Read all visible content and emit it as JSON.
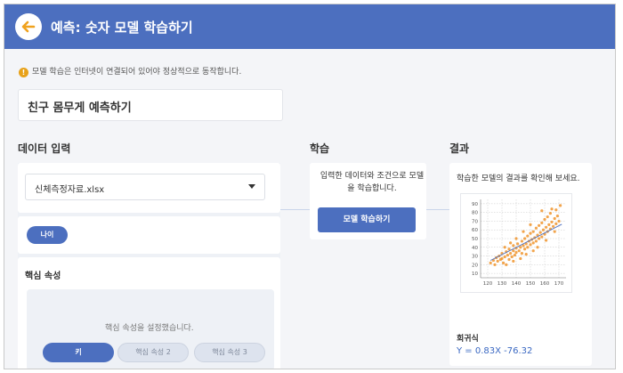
{
  "app": {
    "title": "예측: 숫자 모델 학습하기",
    "notice": "모델 학습은 인터넷이 연결되어 있어야 정상적으로 동작합니다.",
    "project_name": "친구 몸무게 예측하기"
  },
  "data_input": {
    "section_title": "데이터 입력",
    "file_select": "신체측정자료.xlsx",
    "label_chip": "나이",
    "core_attr_title": "핵심 속성",
    "core_attr_placeholder": "핵심 속성을 설정했습니다.",
    "core_attr_chips": [
      "키",
      "핵심 속성 2",
      "핵심 속성 3"
    ]
  },
  "training": {
    "section_title": "학습",
    "description": "입력한 데이터와 조건으로 모델을 학습합니다.",
    "button": "모델 학습하기"
  },
  "result": {
    "section_title": "결과",
    "description": "학습한 모델의 결과를 확인해 보세요.",
    "regression_title": "회귀식",
    "regression_equation": "Y = 0.83X -76.32"
  },
  "colors": {
    "header": "#4c6fbf",
    "accent": "#4c6fbf",
    "scatter": "#f0952e",
    "regression_line": "#4c6fbf",
    "warning": "#e8a21a"
  },
  "icons": {
    "back": "arrow-left-icon",
    "warning": "warning-circle-icon",
    "dropdown": "caret-down-icon"
  },
  "chart_data": {
    "type": "scatter",
    "title": "",
    "xlabel": "",
    "ylabel": "",
    "x_ticks": [
      120,
      130,
      140,
      150,
      160,
      170
    ],
    "y_ticks": [
      10,
      20,
      30,
      40,
      50,
      60,
      70,
      80,
      90
    ],
    "xlim": [
      115,
      175
    ],
    "ylim": [
      5,
      95
    ],
    "grid": true,
    "regression": {
      "slope": 0.83,
      "intercept": -76.32
    },
    "points": [
      [
        122,
        22
      ],
      [
        124,
        25
      ],
      [
        125,
        20
      ],
      [
        126,
        28
      ],
      [
        127,
        24
      ],
      [
        128,
        30
      ],
      [
        129,
        26
      ],
      [
        130,
        27
      ],
      [
        130,
        33
      ],
      [
        131,
        22
      ],
      [
        132,
        29
      ],
      [
        133,
        35
      ],
      [
        134,
        31
      ],
      [
        135,
        26
      ],
      [
        135,
        38
      ],
      [
        136,
        33
      ],
      [
        137,
        29
      ],
      [
        138,
        36
      ],
      [
        138,
        42
      ],
      [
        139,
        31
      ],
      [
        140,
        39
      ],
      [
        140,
        34
      ],
      [
        141,
        44
      ],
      [
        142,
        36
      ],
      [
        143,
        40
      ],
      [
        144,
        33
      ],
      [
        144,
        47
      ],
      [
        145,
        42
      ],
      [
        146,
        38
      ],
      [
        146,
        50
      ],
      [
        147,
        44
      ],
      [
        148,
        40
      ],
      [
        148,
        53
      ],
      [
        149,
        47
      ],
      [
        150,
        43
      ],
      [
        150,
        56
      ],
      [
        151,
        49
      ],
      [
        152,
        45
      ],
      [
        152,
        58
      ],
      [
        153,
        51
      ],
      [
        154,
        47
      ],
      [
        154,
        62
      ],
      [
        155,
        54
      ],
      [
        156,
        50
      ],
      [
        156,
        65
      ],
      [
        157,
        57
      ],
      [
        158,
        52
      ],
      [
        158,
        68
      ],
      [
        159,
        60
      ],
      [
        160,
        55
      ],
      [
        160,
        72
      ],
      [
        161,
        63
      ],
      [
        162,
        58
      ],
      [
        162,
        75
      ],
      [
        163,
        66
      ],
      [
        164,
        61
      ],
      [
        164,
        79
      ],
      [
        165,
        69
      ],
      [
        166,
        64
      ],
      [
        167,
        73
      ],
      [
        168,
        67
      ],
      [
        168,
        83
      ],
      [
        169,
        76
      ],
      [
        170,
        70
      ],
      [
        158,
        82
      ],
      [
        150,
        66
      ],
      [
        145,
        58
      ],
      [
        140,
        50
      ],
      [
        136,
        45
      ],
      [
        132,
        40
      ],
      [
        165,
        84
      ],
      [
        152,
        36
      ],
      [
        147,
        32
      ],
      [
        161,
        48
      ],
      [
        155,
        40
      ],
      [
        143,
        27
      ],
      [
        167,
        58
      ],
      [
        171,
        88
      ],
      [
        138,
        24
      ],
      [
        133,
        20
      ]
    ]
  }
}
